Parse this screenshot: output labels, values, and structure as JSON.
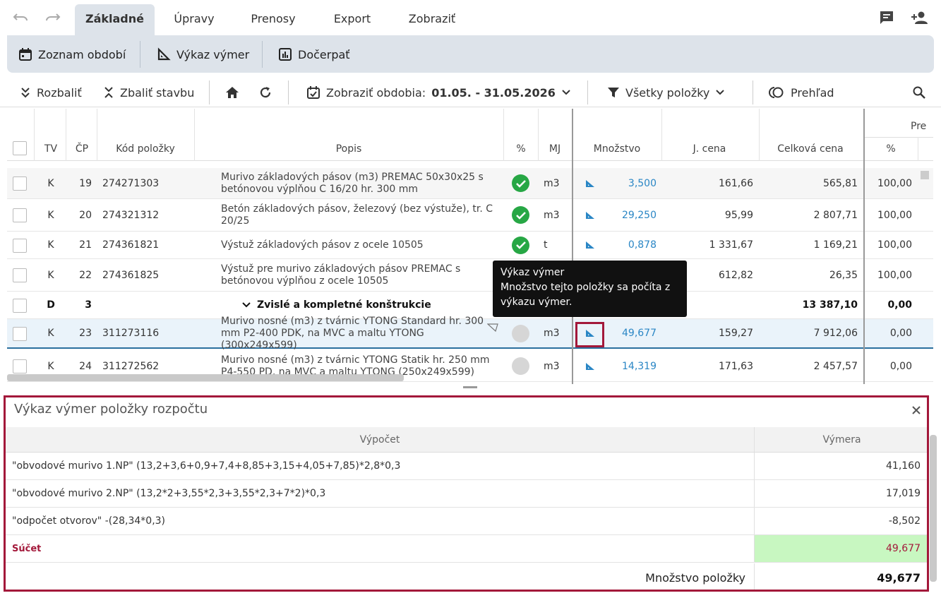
{
  "tabs": [
    {
      "label": "Základné",
      "active": true
    },
    {
      "label": "Úpravy"
    },
    {
      "label": "Prenosy"
    },
    {
      "label": "Export"
    },
    {
      "label": "Zobraziť"
    }
  ],
  "ribbon": {
    "periods": "Zoznam období",
    "measure": "Výkaz výmer",
    "draw": "Dočerpať"
  },
  "toolbar": {
    "expand": "Rozbaliť",
    "collapse": "Zbaliť stavbu",
    "period_label": "Zobraziť obdobia:",
    "period_value": "01.05. - 31.05.2026",
    "filter": "Všetky položky",
    "overview": "Prehľad"
  },
  "columns": {
    "tv": "TV",
    "cp": "ČP",
    "code": "Kód položky",
    "desc": "Popis",
    "pct": "%",
    "mj": "MJ",
    "qty": "Množstvo",
    "unit_price": "J. cena",
    "total": "Celková cena",
    "pct2": "%",
    "group": "Pre"
  },
  "rows": [
    {
      "tv": "K",
      "cp": "19",
      "code": "274271303",
      "desc": "Murivo základových pásov (m3) PREMAC 50x30x25 s betónovou výplňou C 16/20 hr. 300 mm",
      "status": "ok",
      "mj": "m3",
      "qty": "3,500",
      "unit_price": "161,66",
      "total": "565,81",
      "pct": "100,00"
    },
    {
      "tv": "K",
      "cp": "20",
      "code": "274321312",
      "desc": "Betón základových pásov, železový (bez výstuže), tr. C 20/25",
      "status": "ok",
      "mj": "m3",
      "qty": "29,250",
      "unit_price": "95,99",
      "total": "2 807,71",
      "pct": "100,00"
    },
    {
      "tv": "K",
      "cp": "21",
      "code": "274361821",
      "desc": "Výstuž základových pásov z ocele 10505",
      "status": "ok",
      "mj": "t",
      "qty": "0,878",
      "unit_price": "1 331,67",
      "total": "1 169,21",
      "pct": "100,00"
    },
    {
      "tv": "K",
      "cp": "22",
      "code": "274361825",
      "desc": "Výstuž pre murivo základových pásov PREMAC s betónovou výplňou z ocele 10505",
      "status": "",
      "mj": "",
      "qty": "",
      "unit_price": "612,82",
      "total": "26,35",
      "pct": "100,00"
    },
    {
      "tv": "D",
      "cp": "3",
      "code": "",
      "desc": "Zvislé a kompletné konštrukcie",
      "status": "",
      "mj": "",
      "qty": "",
      "unit_price": "",
      "total": "13 387,10",
      "pct": "0,00"
    },
    {
      "tv": "K",
      "cp": "23",
      "code": "311273116",
      "desc": "Murivo nosné (m3) z tvárnic YTONG Standard hr. 300 mm P2-400 PDK, na MVC a maltu YTONG (300x249x599)",
      "status": "gray",
      "mj": "m3",
      "qty": "49,677",
      "unit_price": "159,27",
      "total": "7 912,06",
      "pct": "0,00"
    },
    {
      "tv": "K",
      "cp": "24",
      "code": "311272562",
      "desc": "Murivo nosné (m3) z tvárnic YTONG Statik hr. 250 mm P4-550 PD, na MVC a maltu YTONG (250x249x599)",
      "status": "gray",
      "mj": "m3",
      "qty": "14,319",
      "unit_price": "171,63",
      "total": "2 457,57",
      "pct": "0,00"
    }
  ],
  "tooltip": {
    "title": "Výkaz výmer",
    "body": "Množstvo tejto položky sa počíta z výkazu výmer."
  },
  "panel": {
    "title": "Výkaz výmer položky rozpočtu",
    "col_calc": "Výpočet",
    "col_val": "Výmera",
    "rows": [
      {
        "calc": "\"obvodové murivo 1.NP\" (13,2+3,6+0,9+7,4+8,85+3,15+4,05+7,85)*2,8*0,3",
        "val": "41,160"
      },
      {
        "calc": "\"obvodové murivo 2.NP\" (13,2*2+3,55*2,3+3,55*2,3+7*2)*0,3",
        "val": "17,019"
      },
      {
        "calc": "\"odpočet otvorov\" -(28,34*0,3)",
        "val": "-8,502"
      }
    ],
    "sum_label": "Súčet",
    "sum_value": "49,677",
    "qty_label": "Množstvo položky",
    "qty_value": "49,677"
  },
  "colors": {
    "accent": "#a3183a",
    "link": "#2a86c5",
    "ok": "#27a745",
    "sum_bg": "#c8f7c1"
  }
}
